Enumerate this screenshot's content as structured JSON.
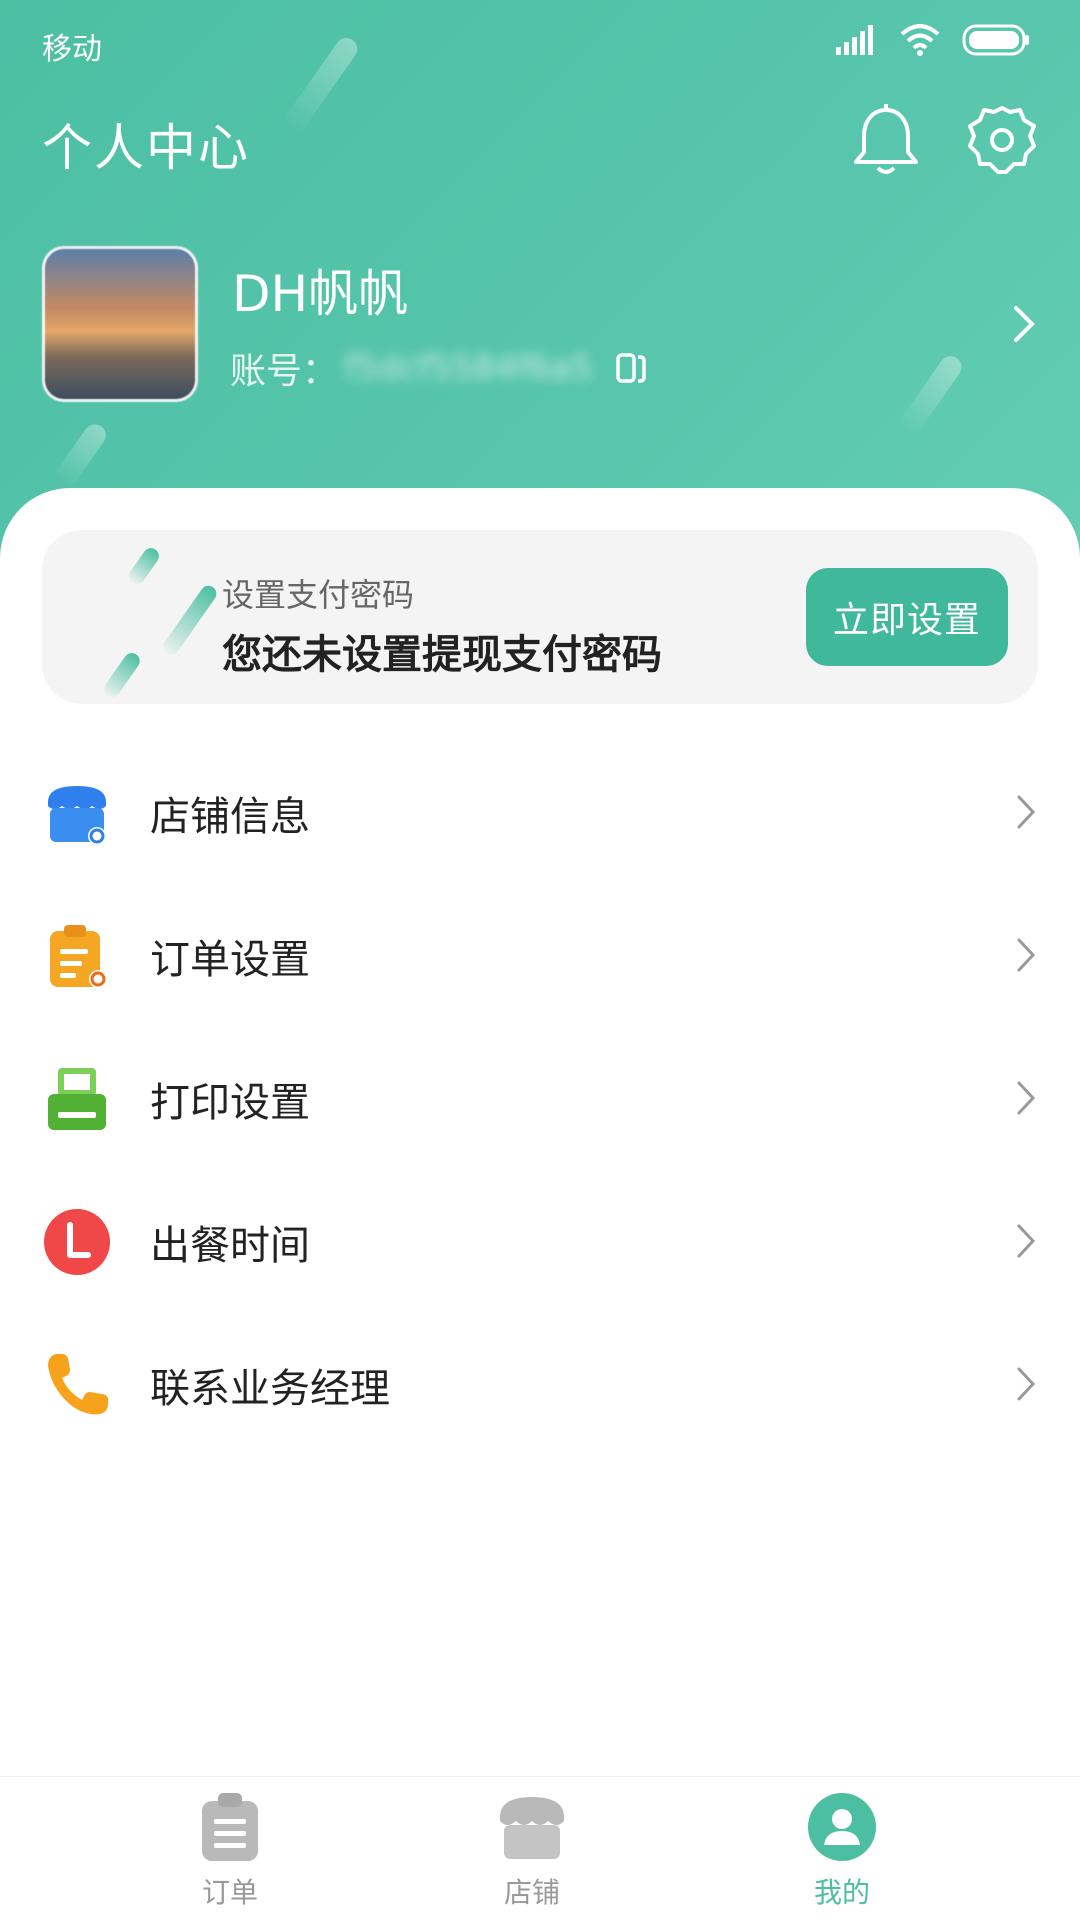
{
  "status_bar": {
    "carrier": "移动"
  },
  "header": {
    "title": "个人中心"
  },
  "profile": {
    "username": "DH帆帆",
    "account_label": "账号：",
    "account_value": "f5dcf5584f6a5"
  },
  "payment_card": {
    "subtitle": "设置支付密码",
    "message": "您还未设置提现支付密码",
    "button_label": "立即设置"
  },
  "menu": {
    "items": [
      {
        "label": "店铺信息",
        "icon": "store-settings-icon",
        "color": "#2f80ed"
      },
      {
        "label": "订单设置",
        "icon": "order-settings-icon",
        "color": "#f5a623"
      },
      {
        "label": "打印设置",
        "icon": "printer-icon",
        "color": "#52b035"
      },
      {
        "label": "出餐时间",
        "icon": "clock-icon",
        "color": "#f04848"
      },
      {
        "label": "联系业务经理",
        "icon": "phone-icon",
        "color": "#f7a21b"
      }
    ]
  },
  "tabbar": {
    "tabs": [
      {
        "label": "订单",
        "icon": "clipboard-icon",
        "active": false
      },
      {
        "label": "店铺",
        "icon": "store-icon",
        "active": false
      },
      {
        "label": "我的",
        "icon": "user-icon",
        "active": true
      }
    ]
  },
  "colors": {
    "primary": "#4cbfa3",
    "button": "#40b89b",
    "inactive": "#999999"
  }
}
